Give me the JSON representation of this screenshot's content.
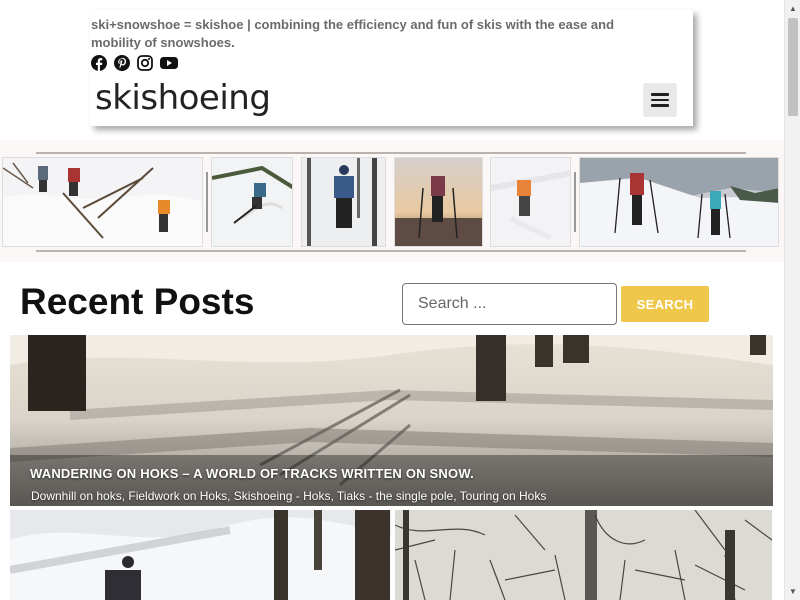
{
  "header": {
    "tagline": "ski+snowshoe = skishoe | combining the efficiency and fun of skis with the ease and mobility of snowshoes.",
    "logo": "skishoeing",
    "social": [
      "facebook-icon",
      "pinterest-icon",
      "instagram-icon",
      "youtube-icon"
    ],
    "menu_icon": "hamburger-menu-icon"
  },
  "main": {
    "section_title": "Recent Posts",
    "search": {
      "placeholder": "Search ...",
      "button_label": "SEARCH"
    },
    "featured_post": {
      "title": "WANDERING ON HOKS – A WORLD OF TRACKS WRITTEN ON SNOW.",
      "tags": "Downhill on hoks, Fieldwork on Hoks, Skishoeing - Hoks, Tiaks - the single pole, Touring on Hoks"
    }
  },
  "colors": {
    "accent": "#efc74a",
    "tagline": "#6b6b6b",
    "banner_bg": "#fbf7f6"
  }
}
